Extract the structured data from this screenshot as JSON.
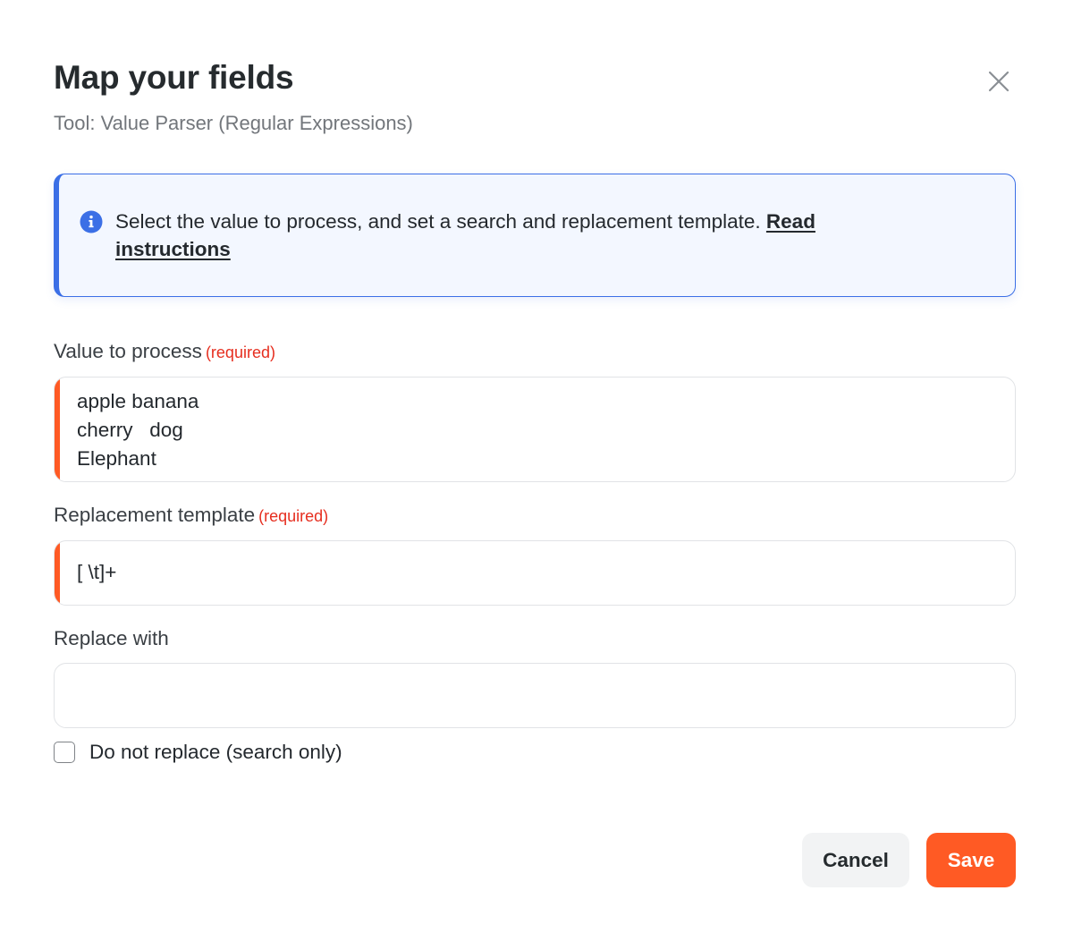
{
  "dialog": {
    "title": "Map your fields",
    "subtitle": "Tool: Value Parser (Regular Expressions)"
  },
  "info": {
    "icon": "info-icon",
    "text": "Select the value to process, and set a search and replacement template. ",
    "link_text": "Read instructions"
  },
  "fields": {
    "value_to_process": {
      "label": "Value to process",
      "required": "(required)",
      "value": "apple banana\ncherry   dog\nElephant"
    },
    "replacement_template": {
      "label": "Replacement template",
      "required": "(required)",
      "value": "[ \\t]+"
    },
    "replace_with": {
      "label": "Replace with",
      "value": ""
    }
  },
  "checkbox": {
    "label": "Do not replace (search only)",
    "checked": false
  },
  "buttons": {
    "cancel": "Cancel",
    "save": "Save"
  },
  "colors": {
    "accent": "#ff5a24",
    "info": "#3b6fe6",
    "required": "#e62e1f"
  }
}
